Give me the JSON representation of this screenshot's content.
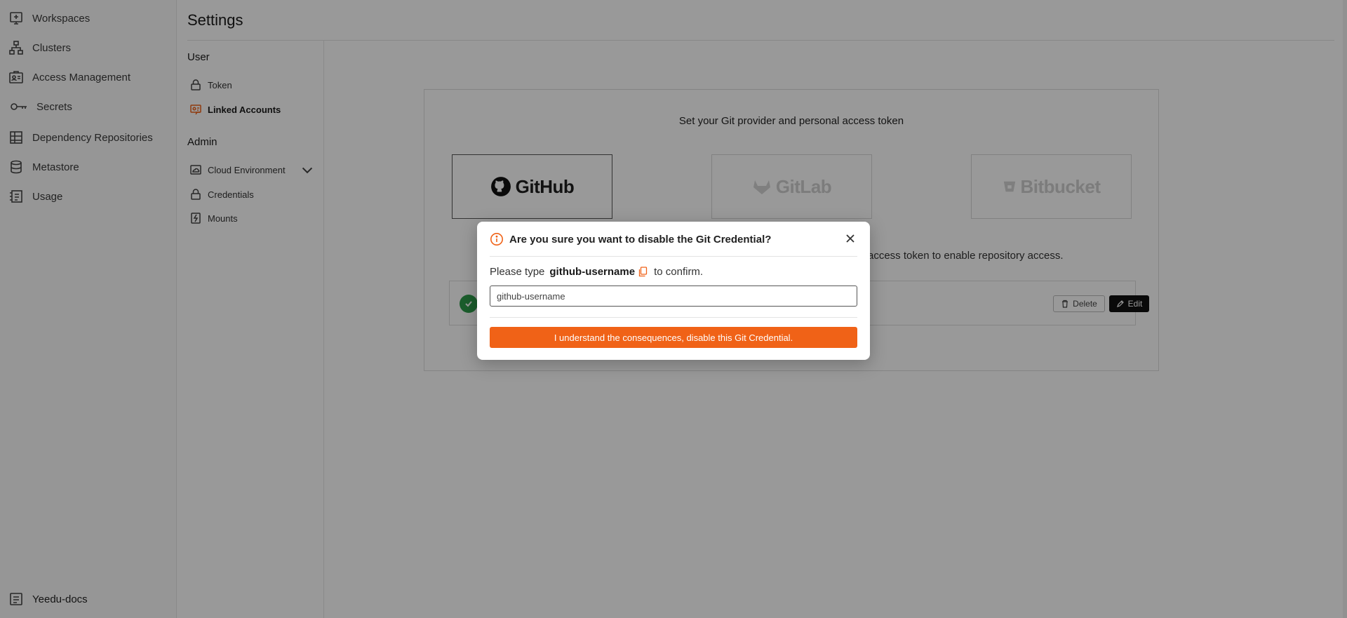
{
  "nav": {
    "items": [
      {
        "label": "Workspaces",
        "icon": "workspace-icon"
      },
      {
        "label": "Clusters",
        "icon": "cluster-icon"
      },
      {
        "label": "Access Management",
        "icon": "access-management-icon"
      },
      {
        "label": "Secrets",
        "icon": "key-icon"
      },
      {
        "label": "Dependency Repositories",
        "icon": "repository-icon"
      },
      {
        "label": "Metastore",
        "icon": "database-icon"
      },
      {
        "label": "Usage",
        "icon": "usage-icon"
      }
    ],
    "footer": {
      "label": "Yeedu-docs",
      "icon": "docs-icon"
    }
  },
  "settings": {
    "title": "Settings",
    "user_heading": "User",
    "user_items": [
      {
        "label": "Token",
        "icon": "lock-icon"
      },
      {
        "label": "Linked Accounts",
        "icon": "linked-accounts-icon",
        "active": true
      }
    ],
    "admin_heading": "Admin",
    "admin_items": [
      {
        "label": "Cloud Environment",
        "icon": "cloud-environment-icon",
        "expandable": true
      },
      {
        "label": "Credentials",
        "icon": "lock-icon"
      },
      {
        "label": "Mounts",
        "icon": "mount-icon"
      }
    ]
  },
  "card": {
    "heading": "Set your Git provider and personal access token",
    "providers": [
      {
        "name": "GitHub",
        "selected": true
      },
      {
        "name": "GitLab",
        "selected": false
      },
      {
        "name": "Bitbucket",
        "selected": false
      }
    ],
    "info_text_visible": "access token to enable repository access.",
    "delete_label": "Delete",
    "edit_label": "Edit"
  },
  "modal": {
    "title": "Are you sure you want to disable the Git Credential?",
    "prompt_prefix": "Please type",
    "username": "github-username",
    "prompt_suffix": "to confirm.",
    "input_value": "github-username",
    "confirm_label": "I understand the consequences, disable this Git Credential."
  },
  "colors": {
    "accent": "#f06217",
    "success": "#2e9c4a",
    "edit_button": "#111111"
  }
}
